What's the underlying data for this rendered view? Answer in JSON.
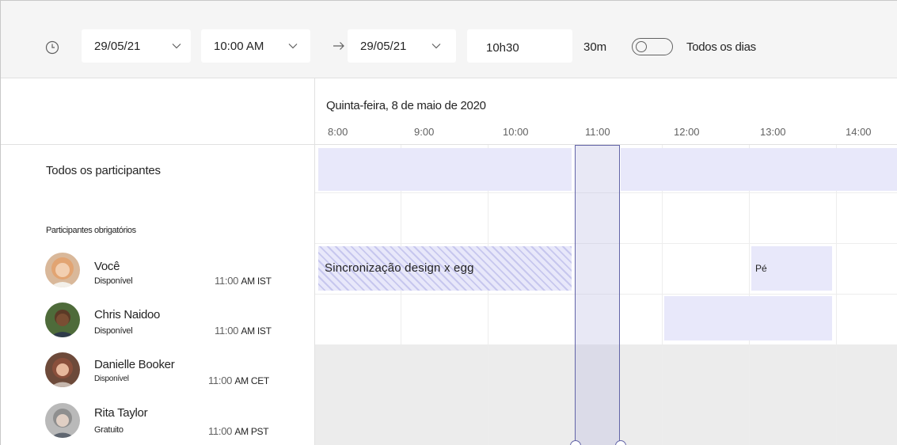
{
  "toolbar": {
    "start_date": "29/05/21",
    "start_time": "10:00 AM",
    "end_date": "29/05/21",
    "end_time": "10h30",
    "duration": "30m",
    "all_day_label": "Todos os dias",
    "all_day_on": false
  },
  "schedule": {
    "date_label": "Quinta-feira, 8 de maio de 2020",
    "hours": [
      "8:00",
      "9:00",
      "10:00",
      "11:00",
      "12:00",
      "13:00",
      "14:00"
    ]
  },
  "participants": {
    "all_label": "Todos os participantes",
    "required_label": "Participantes obrigatórios",
    "people": [
      {
        "name": "Você",
        "status": "Disponível",
        "time": "11:00",
        "ampm": "AM IST"
      },
      {
        "name": "Chris Naidoo",
        "status": "Disponível",
        "time": "11:00",
        "ampm": "AM IST"
      },
      {
        "name": "Danielle Booker",
        "status": "Disponível",
        "time": "11:00",
        "ampm": "AM CET"
      },
      {
        "name": "Rita Taylor",
        "status": "Gratuito",
        "time": "11:00",
        "ampm": "AM PST"
      }
    ]
  },
  "events": {
    "sync_title": "Sincronização design x egg",
    "short_title": "Pé"
  },
  "colors": {
    "accent": "#6264a7",
    "busy_block": "#e8e8fa",
    "toolbar_bg": "#f5f5f5"
  }
}
